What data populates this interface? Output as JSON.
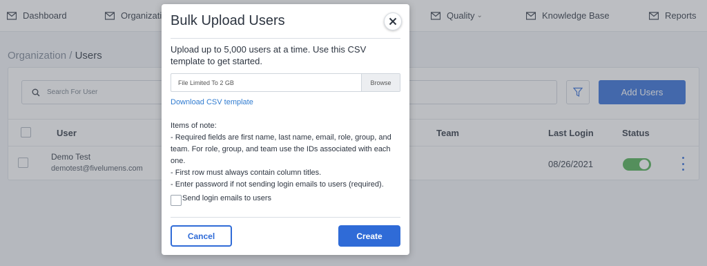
{
  "nav": {
    "dashboard": "Dashboard",
    "organization": "Organization",
    "quality": "Quality",
    "knowledge_base": "Knowledge Base",
    "reports": "Reports"
  },
  "breadcrumb": {
    "parent": "Organization",
    "separator": "/",
    "current": "Users"
  },
  "toolbar": {
    "search_placeholder": "Search For User",
    "add_users": "Add Users"
  },
  "table": {
    "headers": {
      "user": "User",
      "team": "Team",
      "last_login": "Last Login",
      "status": "Status"
    },
    "rows": [
      {
        "name": "Demo Test",
        "email": "demotest@fivelumens.com",
        "last_login": "08/26/2021",
        "status_on": true
      }
    ]
  },
  "modal": {
    "title": "Bulk Upload Users",
    "intro": "Upload up to 5,000 users at a time. Use this CSV template to get started.",
    "file_placeholder": "File Limited To 2 GB",
    "browse": "Browse",
    "download_link": "Download CSV template",
    "notes": [
      "Items of note:",
      "- Required fields are first name, last name, email, role, group, and team. For role, group, and team use the IDs associated with each one.",
      "- First row must always contain column titles.",
      "- Enter password if not sending login emails to users (required)."
    ],
    "send_login_label": "Send login emails to users",
    "cancel": "Cancel",
    "create": "Create"
  },
  "colors": {
    "primary": "#2f6bd7",
    "toggle_on": "#4caf50",
    "link": "#2f7bd0"
  }
}
